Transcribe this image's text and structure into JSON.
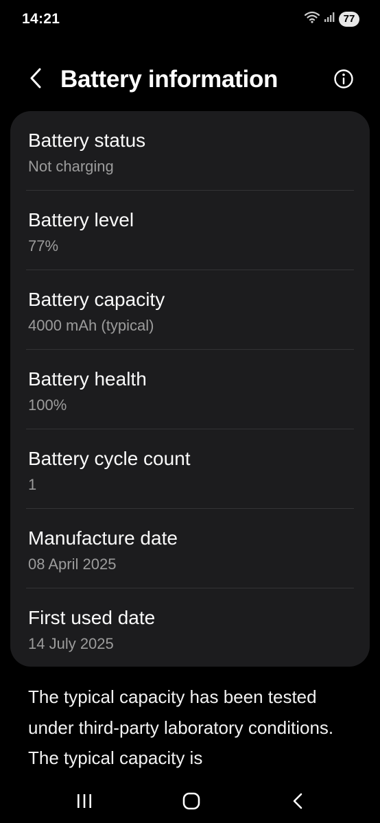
{
  "status_bar": {
    "time": "14:21",
    "battery": "77"
  },
  "header": {
    "title": "Battery information"
  },
  "items": [
    {
      "title": "Battery status",
      "value": "Not charging"
    },
    {
      "title": "Battery level",
      "value": "77%"
    },
    {
      "title": "Battery capacity",
      "value": "4000 mAh (typical)"
    },
    {
      "title": "Battery health",
      "value": "100%"
    },
    {
      "title": "Battery cycle count",
      "value": "1"
    },
    {
      "title": "Manufacture date",
      "value": "08 April 2025"
    },
    {
      "title": "First used date",
      "value": "14 July 2025"
    }
  ],
  "note": "The typical capacity has been tested under third-party laboratory conditions. The typical capacity is",
  "icons": {
    "wifi": "wifi-icon",
    "signal": "signal-icon",
    "back": "back-arrow-icon",
    "info": "info-icon",
    "recents": "recents-icon",
    "home": "home-icon",
    "nav_back": "nav-back-icon"
  },
  "colors": {
    "background": "#000000",
    "card": "#1c1c1e",
    "secondary_text": "#9c9c9c",
    "divider": "#333335"
  }
}
